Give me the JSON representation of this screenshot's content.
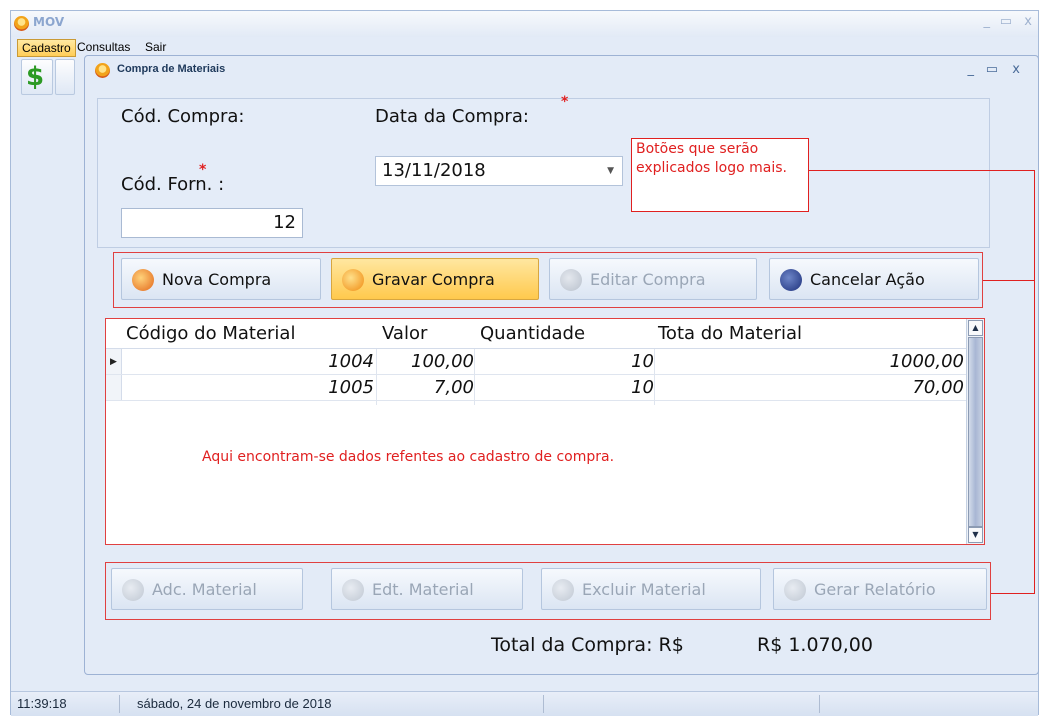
{
  "outer": {
    "title": "MOV",
    "menu": [
      "Cadastro",
      "Consultas",
      "Sair"
    ],
    "status_time": "11:39:18",
    "status_date": "sábado, 24 de novembro de 2018"
  },
  "window": {
    "title": "Compra de Materiais",
    "minimize": "_",
    "maximize": "▭",
    "close": "x"
  },
  "form": {
    "cod_compra_label": "Cód. Compra:",
    "data_label": "Data da Compra:",
    "data_value": "13/11/2018",
    "cod_forn_label": "Cód. Forn. :",
    "cod_forn_value": "12",
    "required_mark": "*"
  },
  "notes": {
    "buttons_note": "Botões que serão explicados logo mais.",
    "grid_note": "Aqui encontram-se dados refentes ao cadastro de compra."
  },
  "action_buttons": [
    {
      "label": "Nova Compra",
      "state": "normal"
    },
    {
      "label": "Gravar Compra",
      "state": "highlight"
    },
    {
      "label": "Editar Compra",
      "state": "disabled"
    },
    {
      "label": "Cancelar Ação",
      "state": "normal"
    }
  ],
  "grid": {
    "columns": [
      "Código do Material",
      "Valor",
      "Quantidade",
      "Tota do Material"
    ],
    "rows": [
      {
        "codigo": "1004",
        "valor": "100,00",
        "quantidade": "10",
        "total": "1000,00",
        "selected": true
      },
      {
        "codigo": "1005",
        "valor": "7,00",
        "quantidade": "10",
        "total": "70,00",
        "selected": false
      }
    ]
  },
  "material_buttons": [
    {
      "label": "Adc. Material"
    },
    {
      "label": "Edt. Material"
    },
    {
      "label": "Excluir Material"
    },
    {
      "label": "Gerar Relatório"
    }
  ],
  "total": {
    "label": "Total da Compra: R$",
    "value": "R$ 1.070,00"
  },
  "colors": {
    "accent_red": "#e02020",
    "highlight": "#ffc94d",
    "window_bg": "#e3ebf7"
  }
}
